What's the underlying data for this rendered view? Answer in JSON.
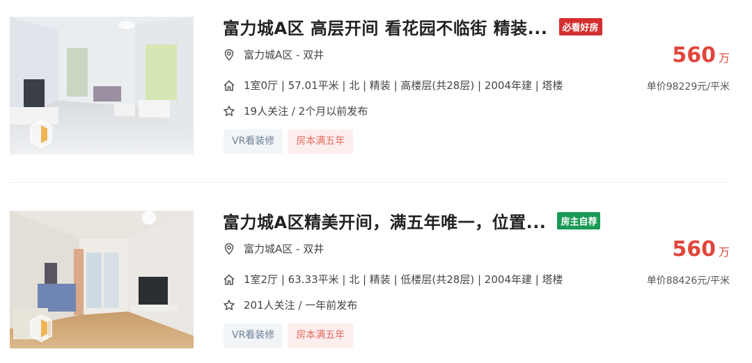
{
  "listings": [
    {
      "title": "富力城A区 高层开间 看花园不临街 精装...",
      "badge": "必看好房",
      "badge_color": "#d42f2f",
      "community": "富力城A区",
      "separator": " - ",
      "district": "双井",
      "attributes": "1室0厅 | 57.01平米 | 北 | 精装 | 高楼层(共28层) | 2004年建 | 塔楼",
      "follow": "19人关注 / 2个月以前发布",
      "tags": [
        "VR看装修",
        "房本满五年"
      ],
      "total_price": "560",
      "total_unit": "万",
      "unit_price": "单价98229元/平米",
      "icons": [
        "location-icon",
        "house-icon",
        "star-icon",
        "vr-icon"
      ]
    },
    {
      "title": "富力城A区精美开间，满五年唯一，位置...",
      "badge": "房主自荐",
      "badge_color": "#1a9a55",
      "community": "富力城A区",
      "separator": " - ",
      "district": "双井",
      "attributes": "1室2厅 | 63.33平米 | 北 | 精装 | 低楼层(共28层) | 2004年建 | 塔楼",
      "follow": "201人关注 / 一年前发布",
      "tags": [
        "VR看装修",
        "房本满五年"
      ],
      "total_price": "560",
      "total_unit": "万",
      "unit_price": "单价88426元/平米",
      "icons": [
        "location-icon",
        "house-icon",
        "star-icon",
        "vr-icon"
      ]
    }
  ],
  "colors": {
    "price": "#e1453b",
    "vr_tag_bg": "#f2f5f8",
    "five_tag_bg": "#fdeeee"
  }
}
